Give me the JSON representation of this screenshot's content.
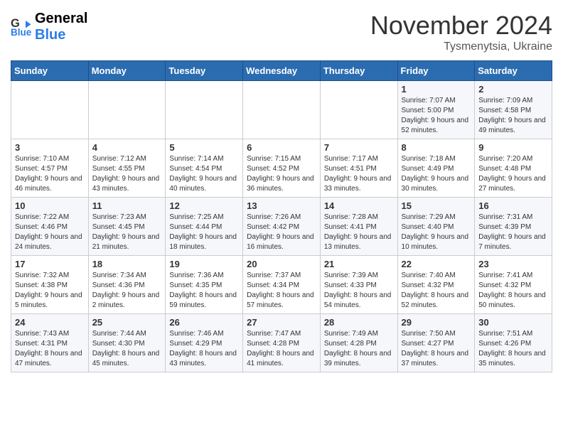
{
  "header": {
    "logo_line1": "General",
    "logo_line2": "Blue",
    "month_title": "November 2024",
    "location": "Tysmenytsia, Ukraine"
  },
  "weekdays": [
    "Sunday",
    "Monday",
    "Tuesday",
    "Wednesday",
    "Thursday",
    "Friday",
    "Saturday"
  ],
  "weeks": [
    [
      {
        "day": "",
        "info": ""
      },
      {
        "day": "",
        "info": ""
      },
      {
        "day": "",
        "info": ""
      },
      {
        "day": "",
        "info": ""
      },
      {
        "day": "",
        "info": ""
      },
      {
        "day": "1",
        "info": "Sunrise: 7:07 AM\nSunset: 5:00 PM\nDaylight: 9 hours and 52 minutes."
      },
      {
        "day": "2",
        "info": "Sunrise: 7:09 AM\nSunset: 4:58 PM\nDaylight: 9 hours and 49 minutes."
      }
    ],
    [
      {
        "day": "3",
        "info": "Sunrise: 7:10 AM\nSunset: 4:57 PM\nDaylight: 9 hours and 46 minutes."
      },
      {
        "day": "4",
        "info": "Sunrise: 7:12 AM\nSunset: 4:55 PM\nDaylight: 9 hours and 43 minutes."
      },
      {
        "day": "5",
        "info": "Sunrise: 7:14 AM\nSunset: 4:54 PM\nDaylight: 9 hours and 40 minutes."
      },
      {
        "day": "6",
        "info": "Sunrise: 7:15 AM\nSunset: 4:52 PM\nDaylight: 9 hours and 36 minutes."
      },
      {
        "day": "7",
        "info": "Sunrise: 7:17 AM\nSunset: 4:51 PM\nDaylight: 9 hours and 33 minutes."
      },
      {
        "day": "8",
        "info": "Sunrise: 7:18 AM\nSunset: 4:49 PM\nDaylight: 9 hours and 30 minutes."
      },
      {
        "day": "9",
        "info": "Sunrise: 7:20 AM\nSunset: 4:48 PM\nDaylight: 9 hours and 27 minutes."
      }
    ],
    [
      {
        "day": "10",
        "info": "Sunrise: 7:22 AM\nSunset: 4:46 PM\nDaylight: 9 hours and 24 minutes."
      },
      {
        "day": "11",
        "info": "Sunrise: 7:23 AM\nSunset: 4:45 PM\nDaylight: 9 hours and 21 minutes."
      },
      {
        "day": "12",
        "info": "Sunrise: 7:25 AM\nSunset: 4:44 PM\nDaylight: 9 hours and 18 minutes."
      },
      {
        "day": "13",
        "info": "Sunrise: 7:26 AM\nSunset: 4:42 PM\nDaylight: 9 hours and 16 minutes."
      },
      {
        "day": "14",
        "info": "Sunrise: 7:28 AM\nSunset: 4:41 PM\nDaylight: 9 hours and 13 minutes."
      },
      {
        "day": "15",
        "info": "Sunrise: 7:29 AM\nSunset: 4:40 PM\nDaylight: 9 hours and 10 minutes."
      },
      {
        "day": "16",
        "info": "Sunrise: 7:31 AM\nSunset: 4:39 PM\nDaylight: 9 hours and 7 minutes."
      }
    ],
    [
      {
        "day": "17",
        "info": "Sunrise: 7:32 AM\nSunset: 4:38 PM\nDaylight: 9 hours and 5 minutes."
      },
      {
        "day": "18",
        "info": "Sunrise: 7:34 AM\nSunset: 4:36 PM\nDaylight: 9 hours and 2 minutes."
      },
      {
        "day": "19",
        "info": "Sunrise: 7:36 AM\nSunset: 4:35 PM\nDaylight: 8 hours and 59 minutes."
      },
      {
        "day": "20",
        "info": "Sunrise: 7:37 AM\nSunset: 4:34 PM\nDaylight: 8 hours and 57 minutes."
      },
      {
        "day": "21",
        "info": "Sunrise: 7:39 AM\nSunset: 4:33 PM\nDaylight: 8 hours and 54 minutes."
      },
      {
        "day": "22",
        "info": "Sunrise: 7:40 AM\nSunset: 4:32 PM\nDaylight: 8 hours and 52 minutes."
      },
      {
        "day": "23",
        "info": "Sunrise: 7:41 AM\nSunset: 4:32 PM\nDaylight: 8 hours and 50 minutes."
      }
    ],
    [
      {
        "day": "24",
        "info": "Sunrise: 7:43 AM\nSunset: 4:31 PM\nDaylight: 8 hours and 47 minutes."
      },
      {
        "day": "25",
        "info": "Sunrise: 7:44 AM\nSunset: 4:30 PM\nDaylight: 8 hours and 45 minutes."
      },
      {
        "day": "26",
        "info": "Sunrise: 7:46 AM\nSunset: 4:29 PM\nDaylight: 8 hours and 43 minutes."
      },
      {
        "day": "27",
        "info": "Sunrise: 7:47 AM\nSunset: 4:28 PM\nDaylight: 8 hours and 41 minutes."
      },
      {
        "day": "28",
        "info": "Sunrise: 7:49 AM\nSunset: 4:28 PM\nDaylight: 8 hours and 39 minutes."
      },
      {
        "day": "29",
        "info": "Sunrise: 7:50 AM\nSunset: 4:27 PM\nDaylight: 8 hours and 37 minutes."
      },
      {
        "day": "30",
        "info": "Sunrise: 7:51 AM\nSunset: 4:26 PM\nDaylight: 8 hours and 35 minutes."
      }
    ]
  ]
}
